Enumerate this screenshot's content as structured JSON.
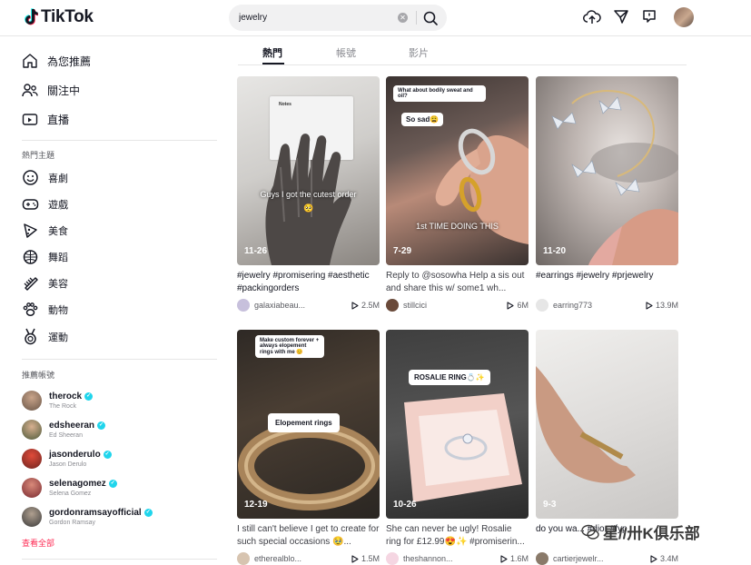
{
  "app": {
    "name": "TikTok"
  },
  "search": {
    "value": "jewelry"
  },
  "sidebar": {
    "nav": [
      {
        "label": "為您推薦"
      },
      {
        "label": "關注中"
      },
      {
        "label": "直播"
      }
    ],
    "topics_title": "熱門主題",
    "topics": [
      {
        "label": "喜劇"
      },
      {
        "label": "遊戲"
      },
      {
        "label": "美食"
      },
      {
        "label": "舞蹈"
      },
      {
        "label": "美容"
      },
      {
        "label": "動物"
      },
      {
        "label": "運動"
      }
    ],
    "accounts_title": "推薦帳號",
    "accounts": [
      {
        "name": "therock",
        "sub": "The Rock",
        "color": "#7a6a5c"
      },
      {
        "name": "edsheeran",
        "sub": "Ed Sheeran",
        "color": "#6c7a5a"
      },
      {
        "name": "jasonderulo",
        "sub": "Jason Derulo",
        "color": "#b23a2e"
      },
      {
        "name": "selenagomez",
        "sub": "Selena Gomez",
        "color": "#a04040"
      },
      {
        "name": "gordonramsayofficial",
        "sub": "Gordon Ramsay",
        "color": "#4a4a4a"
      }
    ],
    "see_all": "查看全部"
  },
  "tabs": [
    {
      "label": "熱門"
    },
    {
      "label": "帳號"
    },
    {
      "label": "影片"
    }
  ],
  "videos": [
    {
      "date": "11-26",
      "desc": "#jewelry #promisering #aesthetic #packingorders",
      "user": "galaxiabeau...",
      "likes": "2.5M",
      "overlay": "Guys I got the cutest order",
      "notes": "Notes"
    },
    {
      "date": "7-29",
      "desc": "Reply to @sosowha Help a sis out and share this w/ some1 wh...",
      "user": "stillcici",
      "likes": "6M",
      "overlay": "1st TIME DOING THIS",
      "bubble1": "What about bodily sweat and oil?",
      "bubble2": "So sad😩"
    },
    {
      "date": "11-20",
      "desc": "#earrings #jewelry #prjewelry",
      "user": "earring773",
      "likes": "13.9M"
    },
    {
      "date": "12-19",
      "desc": "I still can't believe I get to create for such special occasions 🥹...",
      "user": "etherealblo...",
      "likes": "1.5M",
      "bubble1": "Make custom forever + always elopement rings with me 😊",
      "bubble2": "Elopement rings"
    },
    {
      "date": "10-26",
      "desc": "She can never be ugly! Rosalie ring for £12.99😍✨ #promiserin...",
      "user": "theshannon...",
      "likes": "1.6M",
      "bubble1": "ROSALIE RING💍✨"
    },
    {
      "date": "9-3",
      "desc": "do you wa... #dior #fyp",
      "user": "cartierjewelr...",
      "likes": "3.4M"
    }
  ],
  "watermark": "星//卅K俱乐部",
  "colors": {
    "accent": "#fe2c55",
    "verified": "#20d5ec"
  }
}
